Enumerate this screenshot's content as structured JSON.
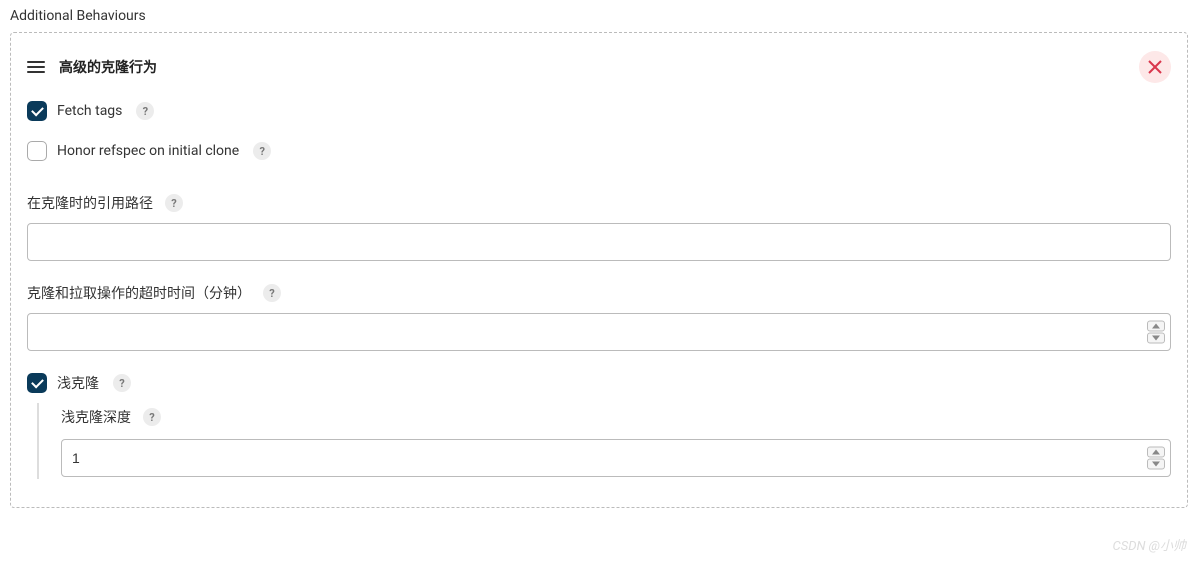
{
  "section": {
    "title": "Additional Behaviours"
  },
  "panel": {
    "title": "高级的克隆行为"
  },
  "checkboxes": {
    "fetchTags": {
      "label": "Fetch tags",
      "checked": true
    },
    "honorRefspec": {
      "label": "Honor refspec on initial clone",
      "checked": false
    },
    "shallowClone": {
      "label": "浅克隆",
      "checked": true
    }
  },
  "fields": {
    "referencePath": {
      "label": "在克隆时的引用路径",
      "value": ""
    },
    "timeout": {
      "label": "克隆和拉取操作的超时时间（分钟）",
      "value": ""
    },
    "shallowDepth": {
      "label": "浅克隆深度",
      "value": "1"
    }
  },
  "help": "?",
  "watermark": "CSDN @小帅"
}
